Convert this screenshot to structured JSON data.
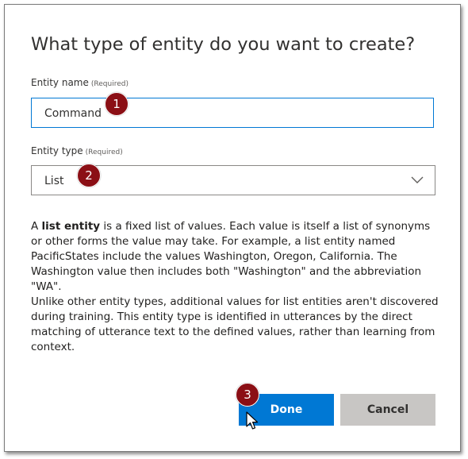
{
  "dialog": {
    "title": "What type of entity do you want to create?",
    "entity_name": {
      "label": "Entity name",
      "required": "(Required)",
      "value": "Command"
    },
    "entity_type": {
      "label": "Entity type",
      "required": "(Required)",
      "selected": "List"
    },
    "description": {
      "intro": "A ",
      "bold_term": "list entity",
      "p1_rest": " is a fixed list of values. Each value is itself a list of synonyms or other forms the value may take. For example, a list entity named PacificStates include the values Washington, Oregon, California. The Washington value then includes both \"Washington\" and the abbreviation \"WA\".",
      "p2": "Unlike other entity types, additional values for list entities aren't discovered during training. This entity type is identified in utterances by the direct matching of utterance text to the defined values, rather than learning from context."
    },
    "buttons": {
      "done": "Done",
      "cancel": "Cancel"
    }
  },
  "callouts": [
    "1",
    "2",
    "3"
  ],
  "colors": {
    "primary": "#0078d4",
    "callout": "#8b0f15",
    "secondary_button": "#c8c6c4"
  },
  "icons": {
    "dropdown": "chevron-down-icon",
    "pointer": "mouse-pointer-icon"
  }
}
